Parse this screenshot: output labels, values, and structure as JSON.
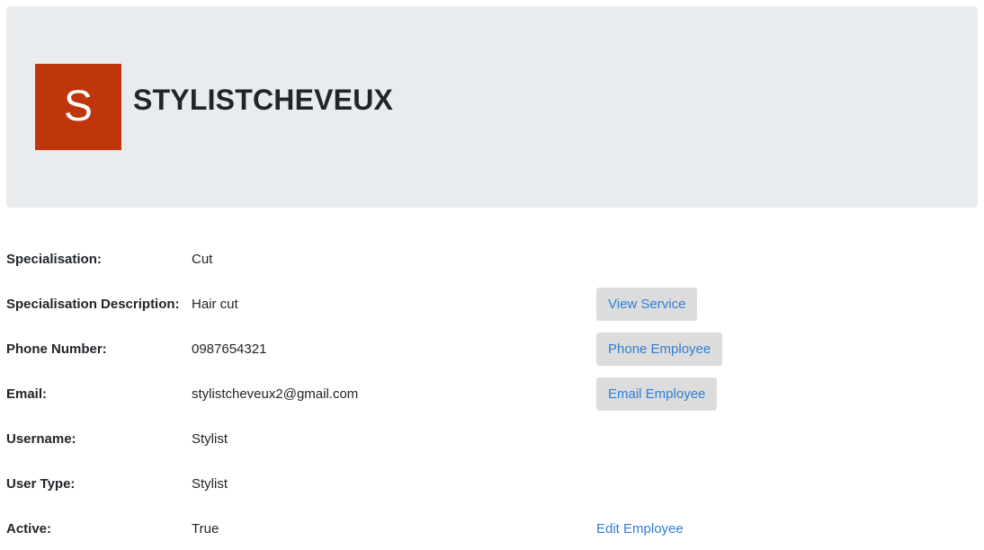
{
  "header": {
    "avatar_letter": "S",
    "avatar_color": "#bf360c",
    "name": "STYLISTCHEVEUX"
  },
  "details": {
    "specialisation": {
      "label": "Specialisation:",
      "value": "Cut"
    },
    "specialisation_description": {
      "label": "Specialisation Description:",
      "value": "Hair cut",
      "action": "View Service"
    },
    "phone": {
      "label": "Phone Number:",
      "value": "0987654321",
      "action": "Phone Employee"
    },
    "email": {
      "label": "Email:",
      "value": "stylistcheveux2@gmail.com",
      "action": "Email Employee"
    },
    "username": {
      "label": "Username:",
      "value": "Stylist"
    },
    "user_type": {
      "label": "User Type:",
      "value": "Stylist"
    },
    "active": {
      "label": "Active:",
      "value": "True",
      "action": "Edit Employee"
    }
  },
  "colors": {
    "header_bg": "#e9ecef",
    "button_bg": "#dcdcdc",
    "link": "#2e7fd6"
  }
}
